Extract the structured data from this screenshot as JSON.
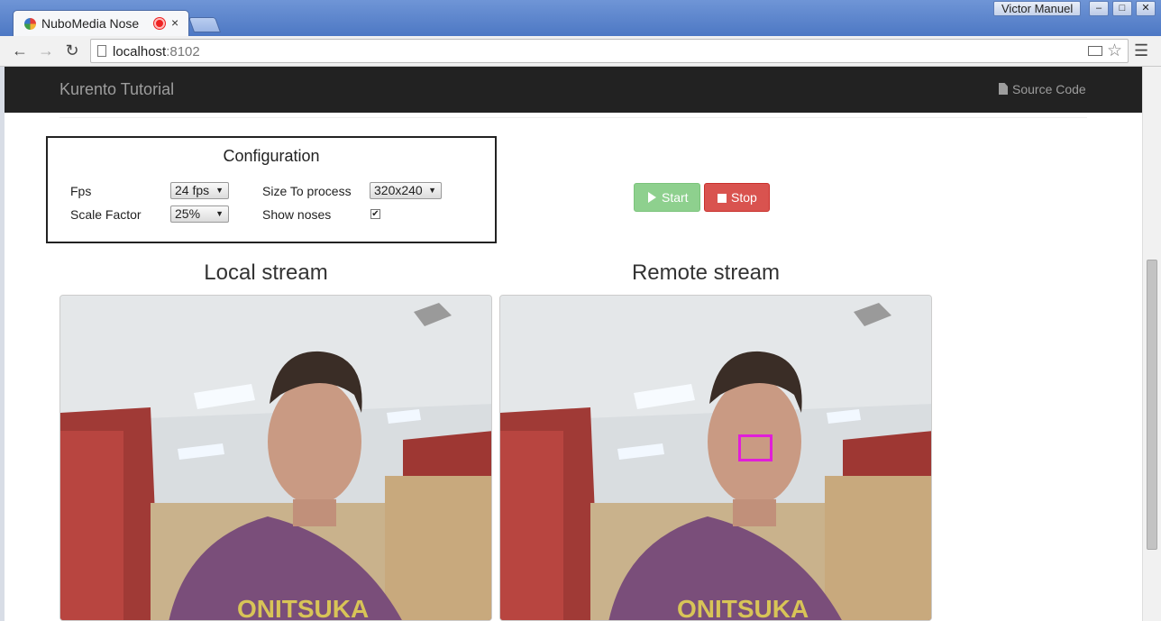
{
  "browser": {
    "tab_title": "NuboMedia Nose",
    "tab_close": "×",
    "profile_name": "Victor Manuel",
    "window_buttons": {
      "minimize": "–",
      "maximize": "□",
      "close": "✕"
    },
    "nav": {
      "back": "←",
      "forward": "→",
      "reload": "↻",
      "menu": "☰",
      "star": "☆"
    },
    "url_host": "localhost",
    "url_port": ":8102"
  },
  "navbar": {
    "brand": "Kurento Tutorial",
    "source_code": "Source Code"
  },
  "configuration": {
    "title": "Configuration",
    "fps_label": "Fps",
    "fps_value": "24 fps",
    "scale_label": "Scale Factor",
    "scale_value": "25%",
    "size_label": "Size To process",
    "size_value": "320x240",
    "noses_label": "Show noses",
    "noses_checked": true,
    "noses_check": "✔"
  },
  "buttons": {
    "start": "Start",
    "stop": "Stop"
  },
  "streams": {
    "local_title": "Local stream",
    "remote_title": "Remote stream"
  },
  "colors": {
    "navbar_bg": "#222222",
    "start_btn": "#8ed08e",
    "stop_btn": "#d9534f",
    "nose_marker": "#e11ed9"
  }
}
